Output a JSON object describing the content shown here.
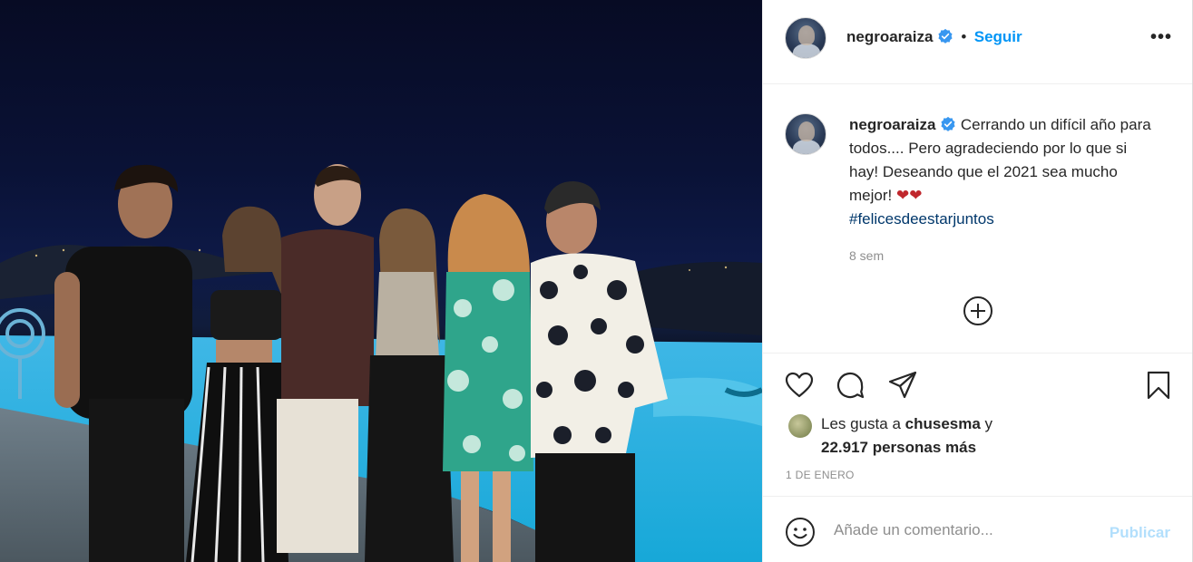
{
  "post": {
    "author": "negroaraiza",
    "verified": true,
    "separator": "•",
    "follow_label": "Seguir",
    "more_label": "•••"
  },
  "caption": {
    "author": "negroaraiza",
    "text": "Cerrando un difícil año para todos.... Pero agradeciendo por lo que si hay! Deseando que el 2021 sea mucho mejor!",
    "hearts": "❤❤",
    "hashtag": "#felicesdeestarjuntos",
    "time_ago": "8 sem"
  },
  "actions": {
    "icons": [
      "heart-icon",
      "comment-icon",
      "share-icon",
      "bookmark-icon"
    ]
  },
  "likes": {
    "prefix": "Les gusta a",
    "liker": "chusesma",
    "conjunction": "y",
    "count_text": "22.917 personas más"
  },
  "date": "1 DE ENERO",
  "comment": {
    "placeholder": "Añade un comentario...",
    "publish_label": "Publicar"
  },
  "colors": {
    "accent": "#0095f6",
    "publish_disabled": "#b2dffc",
    "hashtag": "#00376b",
    "secondary_text": "#8e8e8e"
  }
}
